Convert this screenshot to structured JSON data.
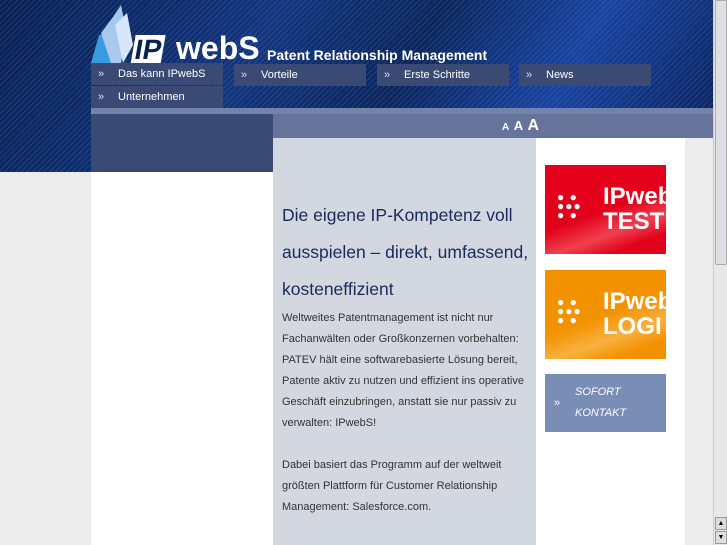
{
  "header": {
    "logo_ip": "IP",
    "logo_webs": "webS",
    "tagline": "Patent Relationship Management"
  },
  "nav": [
    {
      "label": "Das kann IPwebS"
    },
    {
      "label": "Vorteile"
    },
    {
      "label": "Erste Schritte"
    },
    {
      "label": "News"
    },
    {
      "label": "Unternehmen"
    }
  ],
  "font_size_controls": [
    "A",
    "A",
    "A"
  ],
  "main": {
    "heading": "Die eigene IP-Kompetenz voll ausspielen – direkt, umfassend, kosteneffizient",
    "paragraphs": [
      "Weltweites Patentmanagement ist nicht nur Fachanwälten oder Großkonzernen vorbehalten: PATEV hält eine softwarebasierte Lösung bereit, Patente aktiv zu nutzen und effizient ins operative Geschäft einzubringen, anstatt sie nur passiv zu verwalten: IPwebS!",
      "Dabei basiert das Programm auf der weltweit größten Plattform für Customer Relationship Management: Salesforce.com."
    ]
  },
  "sidebar": {
    "test_banner": {
      "line1": "IPweb",
      "line2": "TEST",
      "color": "#e2001a"
    },
    "login_banner": {
      "line1": "IPweb",
      "line2": "LOGI",
      "color": "#f39200"
    },
    "kontakt": {
      "line1": "SOFORT",
      "line2": "KONTAKT"
    }
  }
}
